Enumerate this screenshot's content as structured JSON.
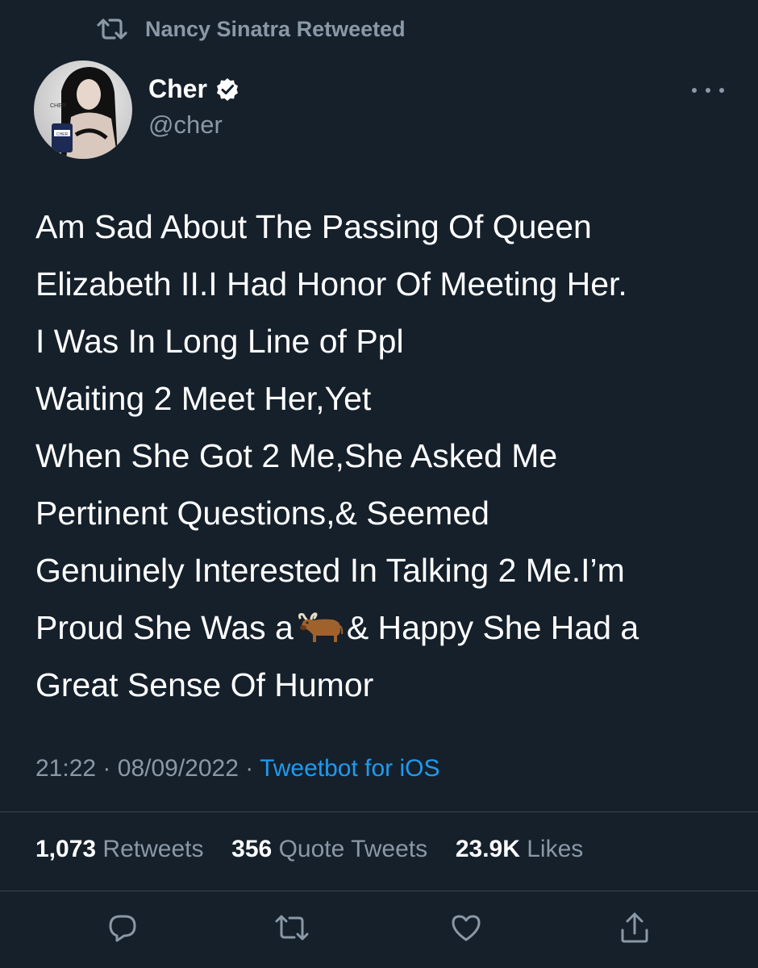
{
  "retweet_header": {
    "icon": "retweet-icon",
    "label": "Nancy Sinatra Retweeted"
  },
  "author": {
    "display_name": "Cher",
    "handle": "@cher",
    "verified": true,
    "verified_icon": "verified-badge-icon",
    "avatar_caption_lines": [
      "CHER",
      "CHER"
    ]
  },
  "tweet": {
    "lines": [
      "Am Sad About The Passing Of Queen",
      "Elizabeth II.I Had Honor Of Meeting Her.",
      "I Was In Long Line of Ppl",
      "Waiting 2 Meet Her,Yet",
      "When She Got 2 Me,She Asked Me",
      "Pertinent Questions,& Seemed",
      "Genuinely Interested In Talking 2 Me.I’m"
    ],
    "line8_before_emoji": "Proud She Was a",
    "emoji_icon": "ox-emoji-icon",
    "line8_after_emoji": "& Happy She Had a",
    "line9": "Great Sense Of Humor"
  },
  "meta": {
    "time": "21:22",
    "separator": "·",
    "date": "08/09/2022",
    "client": "Tweetbot for iOS"
  },
  "stats": {
    "retweets_count": "1,073",
    "retweets_label": "Retweets",
    "quotes_count": "356",
    "quotes_label": "Quote Tweets",
    "likes_count": "23.9K",
    "likes_label": "Likes"
  },
  "actions": [
    {
      "name": "reply",
      "icon": "reply-icon"
    },
    {
      "name": "retweet",
      "icon": "retweet-icon"
    },
    {
      "name": "like",
      "icon": "heart-icon"
    },
    {
      "name": "share",
      "icon": "share-icon"
    }
  ],
  "colors": {
    "background": "#15202b",
    "primary_text": "#ffffff",
    "secondary_text": "#8b98a5",
    "link": "#1d9bf0",
    "divider": "#38444d"
  }
}
